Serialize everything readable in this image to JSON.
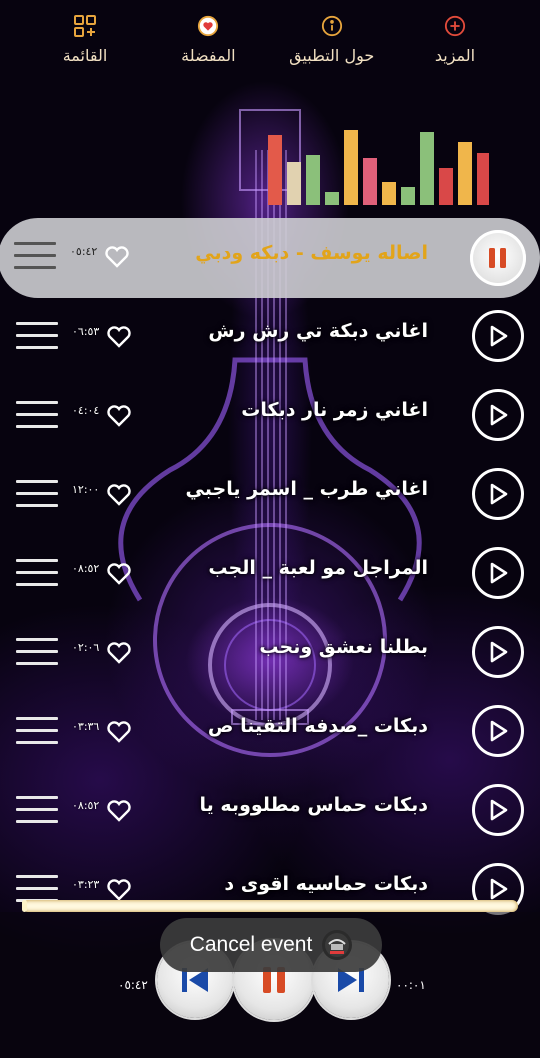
{
  "nav": {
    "more": {
      "label": "المزيد",
      "icon": "plus-circle-icon"
    },
    "about": {
      "label": "حول التطبيق",
      "icon": "info-icon"
    },
    "favorites": {
      "label": "المفضلة",
      "icon": "heart-circle-icon"
    },
    "menu": {
      "label": "القائمة",
      "icon": "grid-add-icon"
    }
  },
  "equalizer_colors": [
    "#e35a4a",
    "#e1d2b0",
    "#8bc07a",
    "#f0b64b",
    "#e0607a",
    "#d94848"
  ],
  "songs": [
    {
      "title": "اصاله يوسف - دبكه ودبي",
      "duration": "٠٥:٤٢",
      "active": true
    },
    {
      "title": "اغاني دبكة تي رش رش",
      "duration": "٠٦:٥٣",
      "active": false
    },
    {
      "title": "اغاني زمر نار دبكات",
      "duration": "٠٤:٠٤",
      "active": false
    },
    {
      "title": "اغاني طرب _ اسمر ياجبي",
      "duration": "١٢:٠٠",
      "active": false
    },
    {
      "title": "المراجل مو لعبة _ الجب",
      "duration": "٠٨:٥٢",
      "active": false
    },
    {
      "title": "بطلنا نعشق ونحب",
      "duration": "٠٢:٠٦",
      "active": false
    },
    {
      "title": "دبكات _صدفه التقينا ص",
      "duration": "٠٣:٣٦",
      "active": false
    },
    {
      "title": "دبكات حماس مطلووبه يا",
      "duration": "٠٨:٥٢",
      "active": false
    },
    {
      "title": "دبكات حماسيه     اقوى د",
      "duration": "٠٣:٢٣",
      "active": false
    }
  ],
  "player": {
    "current_time": "٠٠:٠١",
    "total_time": "٠٥:٤٢",
    "progress": 0.01
  },
  "toast": {
    "text": "Cancel event"
  },
  "colors": {
    "accent_orange": "#e2a41a",
    "nav_icon": "#e7a53d",
    "heart_red": "#e13b3b"
  }
}
